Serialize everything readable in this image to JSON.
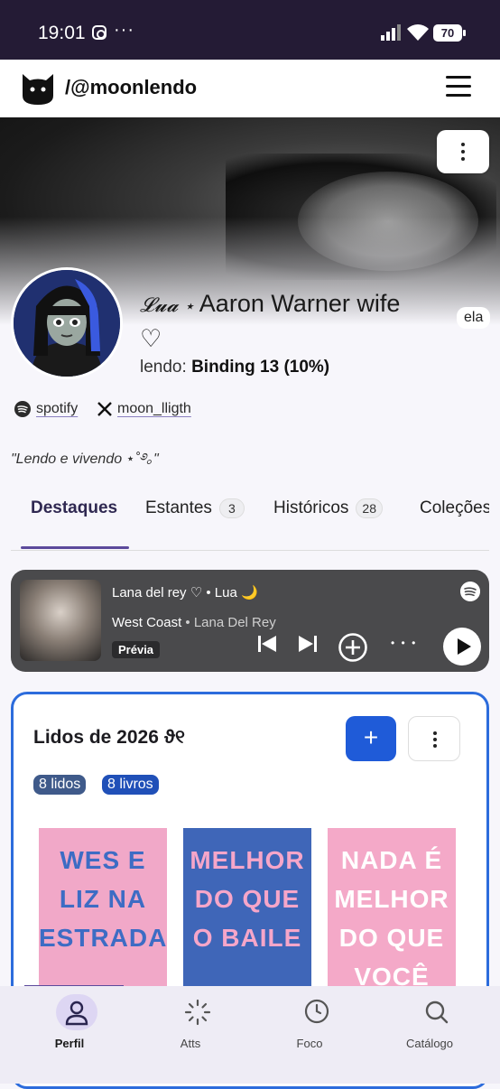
{
  "status_bar": {
    "time": "19:01",
    "dots": "···",
    "battery": "70"
  },
  "header": {
    "handle": "/@moonlendo"
  },
  "profile": {
    "name_script": "𝓛𝓾𝓪 ⋆",
    "name_main": "Aaron Warner wife",
    "name_heart": "♡",
    "pronoun": "ela",
    "reading_label": "lendo:",
    "reading_value": "Binding 13 (10%)",
    "links": [
      {
        "label": "spotify",
        "icon": "spotify-icon"
      },
      {
        "label": "moon_lligth",
        "icon": "x-icon"
      }
    ],
    "bio": "\"Lendo e vivendo ⋆˚࿔｡\""
  },
  "tabs": [
    {
      "label": "Destaques",
      "active": true
    },
    {
      "label": "Estantes",
      "count": "3"
    },
    {
      "label": "Históricos",
      "count": "28"
    },
    {
      "label": "Coleções"
    }
  ],
  "player": {
    "playlist": "Lana del rey ♡ • Lua 🌙",
    "song": "West Coast",
    "artist": "Lana Del Rey",
    "preview_label": "Prévia",
    "more": "• • •"
  },
  "reading_card": {
    "title": "Lidos de 2026 ϑ୧",
    "add_label": "+",
    "chips": [
      {
        "label": "8 lidos",
        "color": "#3f5a8a"
      },
      {
        "label": "8 livros",
        "color": "#2050b8"
      }
    ],
    "books": [
      {
        "title": "WES E LIZ NA ESTRADA",
        "bg": "#f1a8c8",
        "fg": "#3d6cc4"
      },
      {
        "title": "MELHOR DO QUE O BAILE",
        "bg": "#3f66b8",
        "fg": "#f6a6c9"
      },
      {
        "title": "NADA É MELHOR DO QUE VOCÊ",
        "bg": "#f4a9c8",
        "fg": "#ffffff"
      }
    ]
  },
  "bottom_nav": [
    {
      "label": "Perfil",
      "icon": "person-icon",
      "active": true
    },
    {
      "label": "Atts",
      "icon": "loading-icon"
    },
    {
      "label": "Foco",
      "icon": "clock-icon"
    },
    {
      "label": "Catálogo",
      "icon": "search-icon"
    }
  ]
}
